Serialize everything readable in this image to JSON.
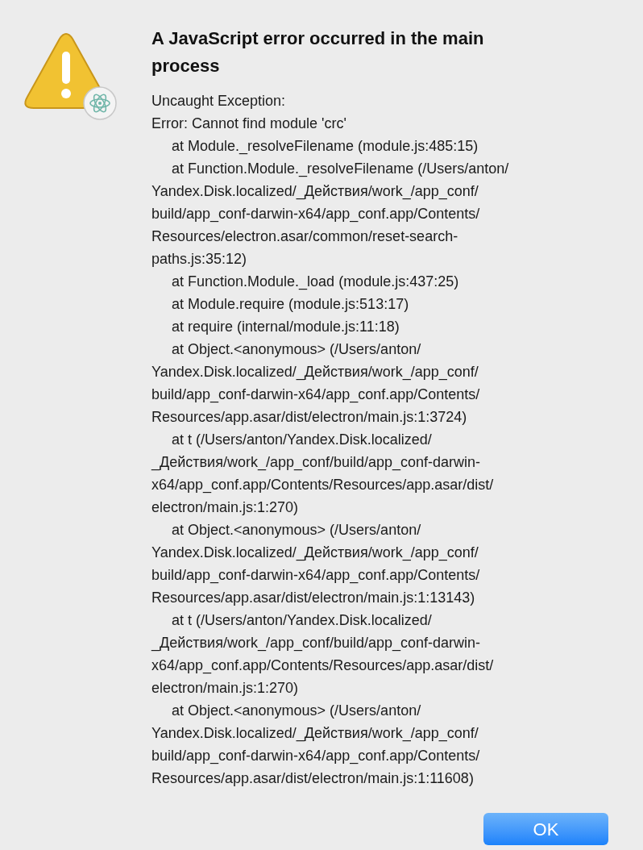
{
  "dialog": {
    "title": "A JavaScript error occurred in the main process",
    "lines": [
      {
        "kind": "plain",
        "text": "Uncaught Exception:"
      },
      {
        "kind": "plain",
        "text": "Error: Cannot find module 'crc'"
      },
      {
        "kind": "frame",
        "text": "at Module._resolveFilename (module.js:485:15)"
      },
      {
        "kind": "frame",
        "text": "at Function.Module._resolveFilename (/Users/anton/"
      },
      {
        "kind": "plain",
        "text": "Yandex.Disk.localized/_Действия/work_/app_conf/"
      },
      {
        "kind": "plain",
        "text": "build/app_conf-darwin-x64/app_conf.app/Contents/"
      },
      {
        "kind": "plain",
        "text": "Resources/electron.asar/common/reset-search-"
      },
      {
        "kind": "plain",
        "text": "paths.js:35:12)"
      },
      {
        "kind": "frame",
        "text": "at Function.Module._load (module.js:437:25)"
      },
      {
        "kind": "frame",
        "text": "at Module.require (module.js:513:17)"
      },
      {
        "kind": "frame",
        "text": "at require (internal/module.js:11:18)"
      },
      {
        "kind": "frame",
        "text": "at Object.<anonymous> (/Users/anton/"
      },
      {
        "kind": "plain",
        "text": "Yandex.Disk.localized/_Действия/work_/app_conf/"
      },
      {
        "kind": "plain",
        "text": "build/app_conf-darwin-x64/app_conf.app/Contents/"
      },
      {
        "kind": "plain",
        "text": "Resources/app.asar/dist/electron/main.js:1:3724)"
      },
      {
        "kind": "frame",
        "text": "at t (/Users/anton/Yandex.Disk.localized/"
      },
      {
        "kind": "plain",
        "text": "_Действия/work_/app_conf/build/app_conf-darwin-"
      },
      {
        "kind": "plain",
        "text": "x64/app_conf.app/Contents/Resources/app.asar/dist/"
      },
      {
        "kind": "plain",
        "text": "electron/main.js:1:270)"
      },
      {
        "kind": "frame",
        "text": "at Object.<anonymous> (/Users/anton/"
      },
      {
        "kind": "plain",
        "text": "Yandex.Disk.localized/_Действия/work_/app_conf/"
      },
      {
        "kind": "plain",
        "text": "build/app_conf-darwin-x64/app_conf.app/Contents/"
      },
      {
        "kind": "plain",
        "text": "Resources/app.asar/dist/electron/main.js:1:13143)"
      },
      {
        "kind": "frame",
        "text": "at t (/Users/anton/Yandex.Disk.localized/"
      },
      {
        "kind": "plain",
        "text": "_Действия/work_/app_conf/build/app_conf-darwin-"
      },
      {
        "kind": "plain",
        "text": "x64/app_conf.app/Contents/Resources/app.asar/dist/"
      },
      {
        "kind": "plain",
        "text": "electron/main.js:1:270)"
      },
      {
        "kind": "frame",
        "text": "at Object.<anonymous> (/Users/anton/"
      },
      {
        "kind": "plain",
        "text": "Yandex.Disk.localized/_Действия/work_/app_conf/"
      },
      {
        "kind": "plain",
        "text": "build/app_conf-darwin-x64/app_conf.app/Contents/"
      },
      {
        "kind": "plain",
        "text": "Resources/app.asar/dist/electron/main.js:1:11608)"
      }
    ],
    "button": "OK"
  }
}
